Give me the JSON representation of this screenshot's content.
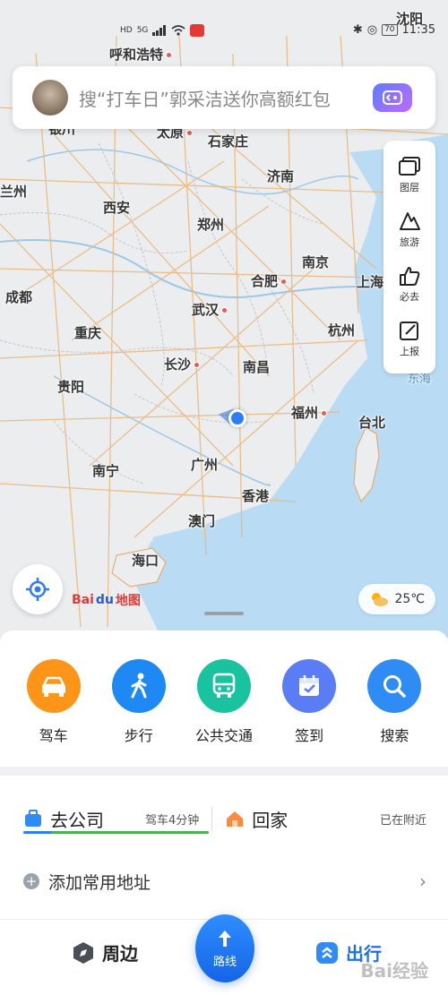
{
  "status_bar": {
    "left_icons": [
      "HD",
      "5G"
    ],
    "top_right_city": "沈阳",
    "time": "11:35",
    "battery": "70"
  },
  "search": {
    "placeholder": "搜“打车日”郭采洁送你高额红包"
  },
  "map_tools": [
    {
      "icon": "layers-icon",
      "label": "图层"
    },
    {
      "icon": "travel-icon",
      "label": "旅游"
    },
    {
      "icon": "thumbs-up-icon",
      "label": "必去"
    },
    {
      "icon": "report-icon",
      "label": "上报"
    }
  ],
  "cities": [
    {
      "name": "呼和浩特"
    },
    {
      "name": "银川"
    },
    {
      "name": "太原"
    },
    {
      "name": "石家庄"
    },
    {
      "name": "兰州"
    },
    {
      "name": "西安"
    },
    {
      "name": "郑州"
    },
    {
      "name": "济南"
    },
    {
      "name": "成都"
    },
    {
      "name": "合肥"
    },
    {
      "name": "南京"
    },
    {
      "name": "上海"
    },
    {
      "name": "重庆"
    },
    {
      "name": "武汉"
    },
    {
      "name": "杭州"
    },
    {
      "name": "长沙"
    },
    {
      "name": "南昌"
    },
    {
      "name": "贵阳"
    },
    {
      "name": "福州"
    },
    {
      "name": "台北"
    },
    {
      "name": "南宁"
    },
    {
      "name": "广州"
    },
    {
      "name": "香港"
    },
    {
      "name": "澳门"
    },
    {
      "name": "海口"
    },
    {
      "name": "东海"
    }
  ],
  "map": {
    "logo_bai": "Bai",
    "logo_du": "du",
    "logo_text": "地图",
    "weather": "25℃"
  },
  "actions": [
    {
      "label": "驾车",
      "icon": "car-icon",
      "color": "#ff9518"
    },
    {
      "label": "步行",
      "icon": "walk-icon",
      "color": "#1e88f5"
    },
    {
      "label": "公共交通",
      "icon": "bus-icon",
      "color": "#19c3a0"
    },
    {
      "label": "签到",
      "icon": "calendar-check-icon",
      "color": "#5a7cf4"
    },
    {
      "label": "搜索",
      "icon": "search-icon",
      "color": "#2f8cf5"
    }
  ],
  "places": {
    "company": {
      "name": "去公司",
      "info": "驾车4分钟"
    },
    "home": {
      "name": "回家",
      "info": "已在附近"
    },
    "add_label": "添加常用地址"
  },
  "tabbar": {
    "nearby": "周边",
    "route": "路线",
    "trip": "出行"
  },
  "watermark": "Bai经验"
}
